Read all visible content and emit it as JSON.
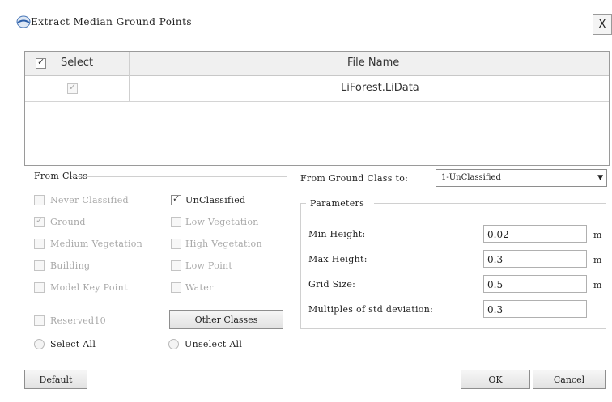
{
  "window": {
    "title": "Extract Median Ground Points",
    "close_label": "X"
  },
  "file_table": {
    "headers": {
      "select": "Select",
      "file_name": "File Name"
    },
    "rows": [
      {
        "selected": true,
        "file_name": "LiForest.LiData"
      }
    ]
  },
  "from_class": {
    "title": "From Class",
    "classes": [
      {
        "label": "Never Classified",
        "checked": false,
        "enabled": false
      },
      {
        "label": "UnClassified",
        "checked": true,
        "enabled": true
      },
      {
        "label": "Ground",
        "checked": true,
        "enabled": false
      },
      {
        "label": "Low Vegetation",
        "checked": false,
        "enabled": false
      },
      {
        "label": "Medium Vegetation",
        "checked": false,
        "enabled": false
      },
      {
        "label": "High Vegetation",
        "checked": false,
        "enabled": false
      },
      {
        "label": "Building",
        "checked": false,
        "enabled": false
      },
      {
        "label": "Low Point",
        "checked": false,
        "enabled": false
      },
      {
        "label": "Model Key Point",
        "checked": false,
        "enabled": false
      },
      {
        "label": "Water",
        "checked": false,
        "enabled": false
      },
      {
        "label": "Reserved10",
        "checked": false,
        "enabled": false
      }
    ],
    "other_classes_label": "Other Classes",
    "select_all_label": "Select All",
    "unselect_all_label": "Unselect All"
  },
  "ground_class": {
    "label": "From Ground Class to:",
    "selected": "1-UnClassified"
  },
  "parameters": {
    "title": "Parameters",
    "min_height": {
      "label": "Min Height:",
      "value": "0.02",
      "unit": "m"
    },
    "max_height": {
      "label": "Max Height:",
      "value": "0.3",
      "unit": "m"
    },
    "grid_size": {
      "label": "Grid Size:",
      "value": "0.5",
      "unit": "m"
    },
    "multiples": {
      "label": "Multiples of std deviation:",
      "value": "0.3"
    }
  },
  "buttons": {
    "default": "Default",
    "ok": "OK",
    "cancel": "Cancel"
  }
}
